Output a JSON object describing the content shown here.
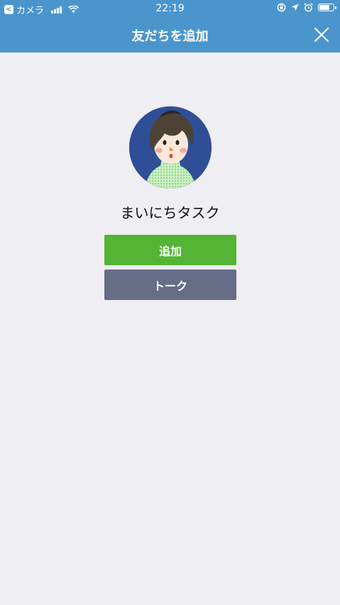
{
  "status_bar": {
    "back_app": "カメラ",
    "time": "22:19",
    "battery_level": 0.75
  },
  "nav": {
    "title": "友だちを追加"
  },
  "profile": {
    "name": "まいにちタスク"
  },
  "actions": {
    "add_label": "追加",
    "talk_label": "トーク"
  },
  "colors": {
    "header": "#4a96cc",
    "background": "#eeeef3",
    "add_button": "#54b535",
    "talk_button": "#666d86"
  },
  "icons": {
    "back": "chevron-left-icon",
    "signal": "signal-icon",
    "wifi": "wifi-icon",
    "orientation_lock": "orientation-lock-icon",
    "location": "location-arrow-icon",
    "alarm": "alarm-icon",
    "battery": "battery-icon",
    "close": "close-icon"
  }
}
